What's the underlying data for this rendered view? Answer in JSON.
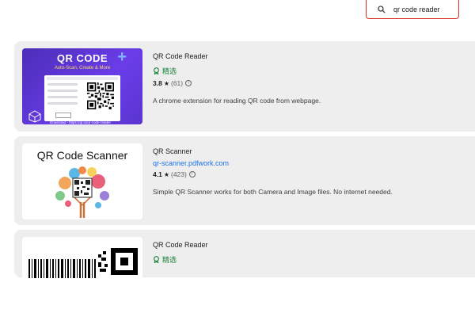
{
  "search": {
    "value": "qr code reader",
    "placeholder": ""
  },
  "results": [
    {
      "name": "QR Code Reader",
      "badge": "精选",
      "rating": "3.8",
      "rating_count": "(61)",
      "description": "A chrome extension for reading QR code from webpage.",
      "thumbnail": {
        "title": "QR CODE",
        "subtitle": "Auto-Scan, Create & More",
        "footer": "Download - https://qr.io/qr-code-reader"
      }
    },
    {
      "name": "QR Scanner",
      "link": "qr-scanner.pdfwork.com",
      "rating": "4.1",
      "rating_count": "(423)",
      "description": "Simple QR Scanner works for both Camera and Image files. No internet needed.",
      "thumbnail": {
        "title": "QR Code Scanner"
      }
    },
    {
      "name": "QR Code Reader",
      "badge": "精选"
    }
  ],
  "colors": {
    "badge_green": "#188038",
    "link_blue": "#1a73e8",
    "search_border": "#d93025",
    "card_bg": "#eeeeee"
  }
}
